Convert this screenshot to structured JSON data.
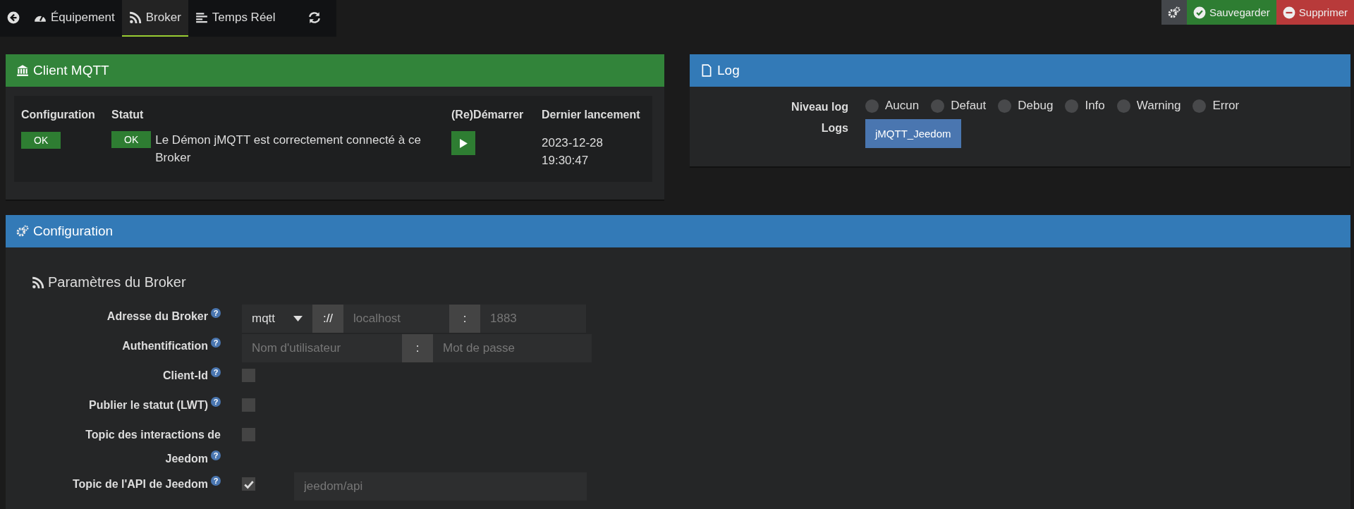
{
  "nav": {
    "tabs": [
      {
        "kind": "back",
        "selected": false
      },
      {
        "kind": "gauge",
        "label": "Équipement",
        "selected": false
      },
      {
        "kind": "rss",
        "label": "Broker",
        "selected": true
      },
      {
        "kind": "lines",
        "label": "Temps Réel",
        "selected": false
      },
      {
        "kind": "refresh",
        "selected": false
      }
    ],
    "actions": [
      {
        "kind": "settings"
      },
      {
        "kind": "save",
        "label": "Sauvegarder"
      },
      {
        "kind": "delete",
        "label": "Supprimer"
      }
    ]
  },
  "client_panel": {
    "title": "Client MQTT",
    "columns": [
      "Configuration",
      "Statut",
      "(Re)Démarrer",
      "Dernier lancement"
    ],
    "configuration_badge": "OK",
    "status_badge": "OK",
    "status_text": "Le Démon jMQTT est correctement connecté à ce Broker",
    "last_launch": "2023-12-28 19:30:47"
  },
  "log_panel": {
    "title": "Log",
    "level_label": "Niveau log",
    "levels": [
      {
        "label": "Aucun",
        "selected": false
      },
      {
        "label": "Defaut",
        "selected": false
      },
      {
        "label": "Debug",
        "selected": false
      },
      {
        "label": "Info",
        "selected": false
      },
      {
        "label": "Warning",
        "selected": false
      },
      {
        "label": "Error",
        "selected": false
      }
    ],
    "logs_label": "Logs",
    "log_button": "jMQTT_Jeedom"
  },
  "config_panel": {
    "title": "Configuration",
    "section_title": "Paramètres du Broker",
    "rows": [
      {
        "kind": "address",
        "label": "Adresse du Broker",
        "help": "?",
        "protocol": "mqtt",
        "separator": "://",
        "host_placeholder": "localhost",
        "port_separator": ":",
        "port_placeholder": "1883"
      },
      {
        "kind": "auth",
        "label": "Authentification",
        "help": "?",
        "user_placeholder": "Nom d'utilisateur",
        "separator": ":",
        "password_placeholder": "Mot de passe"
      },
      {
        "kind": "checkbox",
        "label": "Client-Id",
        "help": "?",
        "checked": false
      },
      {
        "kind": "checkbox",
        "label": "Publier le statut (LWT)",
        "help": "?",
        "checked": false
      },
      {
        "kind": "checkbox",
        "label": "Topic des interactions de Jeedom",
        "help": "?",
        "checked": false
      },
      {
        "kind": "checkbox_field",
        "label": "Topic de l'API de Jeedom",
        "help": "?",
        "checked": true,
        "placeholder": "jeedom/api"
      }
    ]
  }
}
